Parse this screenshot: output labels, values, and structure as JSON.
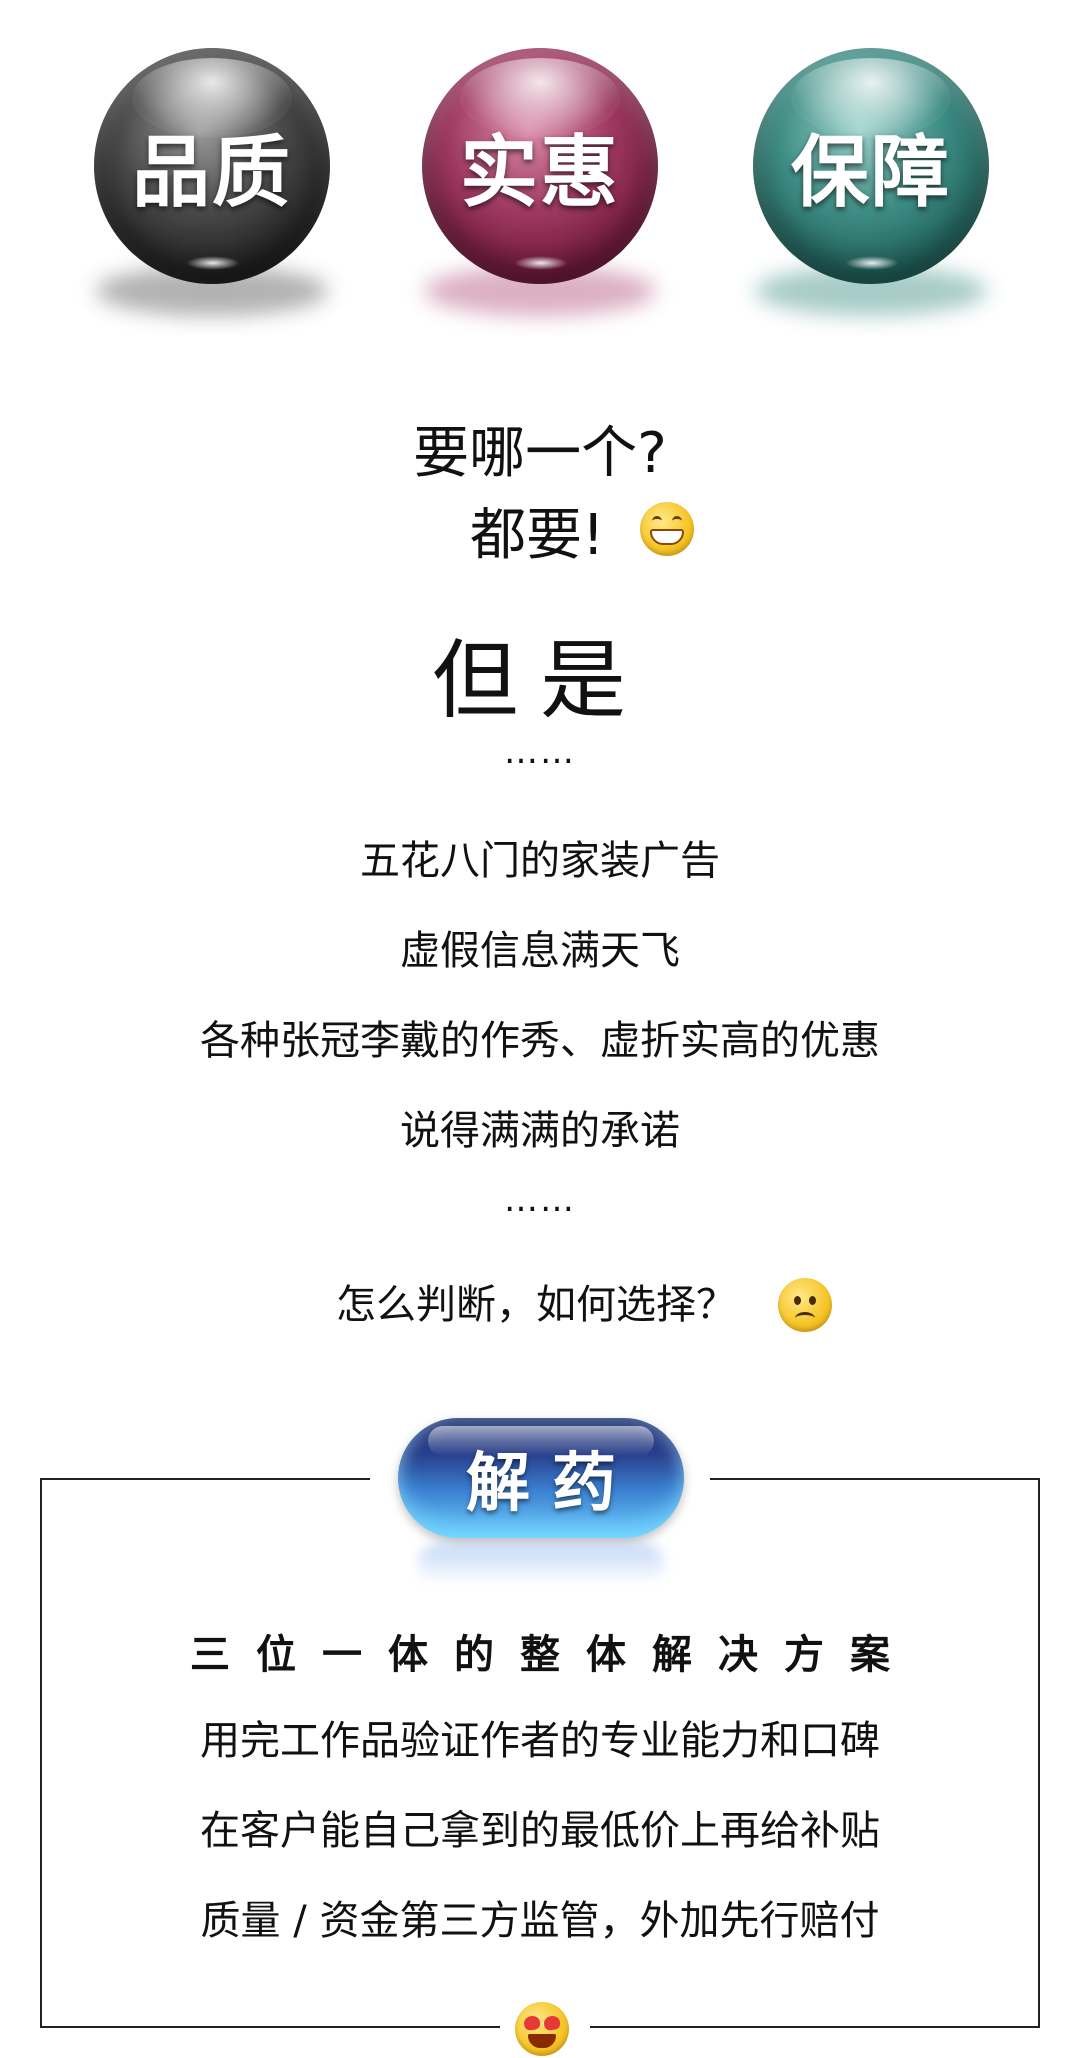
{
  "spheres": [
    {
      "label": "品质",
      "color": "#1c1c1c"
    },
    {
      "label": "实惠",
      "color": "#8a2148"
    },
    {
      "label": "保障",
      "color": "#2e6f68"
    }
  ],
  "intro": {
    "question": "要哪一个?",
    "answer": "都要!",
    "answer_emoji": "grinning-face-icon",
    "but": "但是",
    "ellipsis": "……"
  },
  "problems": [
    "五花八门的家装广告",
    "虚假信息满天飞",
    "各种张冠李戴的作秀、虚折实高的优惠",
    "说得满满的承诺"
  ],
  "problems_ellipsis": "……",
  "ask": {
    "text": "怎么判断，如何选择？",
    "emoji": "sad-face-icon"
  },
  "solution": {
    "badge": "解药",
    "heading": "三位一体的整体解决方案",
    "points": [
      "用完工作品验证作者的专业能力和口碑",
      "在客户能自己拿到的最低价上再给补贴",
      "质量 / 资金第三方监管，外加先行赔付"
    ],
    "footer_emoji": "heart-eyes-face-icon",
    "accent_color": "#3a7fd0"
  }
}
